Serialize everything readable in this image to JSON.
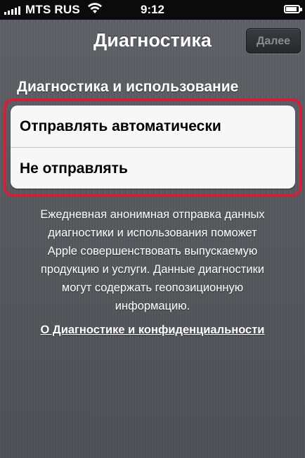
{
  "status_bar": {
    "carrier": "MTS RUS",
    "time": "9:12",
    "icons": [
      "signal-icon",
      "wifi-icon",
      "battery-icon"
    ]
  },
  "nav": {
    "title": "Диагностика",
    "next_label": "Далее"
  },
  "section": {
    "header": "Диагностика и использование",
    "options": [
      {
        "label": "Отправлять автоматически"
      },
      {
        "label": "Не отправлять"
      }
    ]
  },
  "description": {
    "lines": [
      "Ежедневная анонимная отправка данных",
      "диагностики и использования поможет",
      "Apple совершенствовать выпускаемую",
      "продукцию и услуги. Данные диагностики",
      "могут содержать геопозиционную",
      "информацию."
    ]
  },
  "privacy_link": "О Диагностике и конфиденциальности",
  "colors": {
    "highlight": "#d21f3a",
    "background": "#55585e",
    "option_bg": "#f7f7f7"
  }
}
